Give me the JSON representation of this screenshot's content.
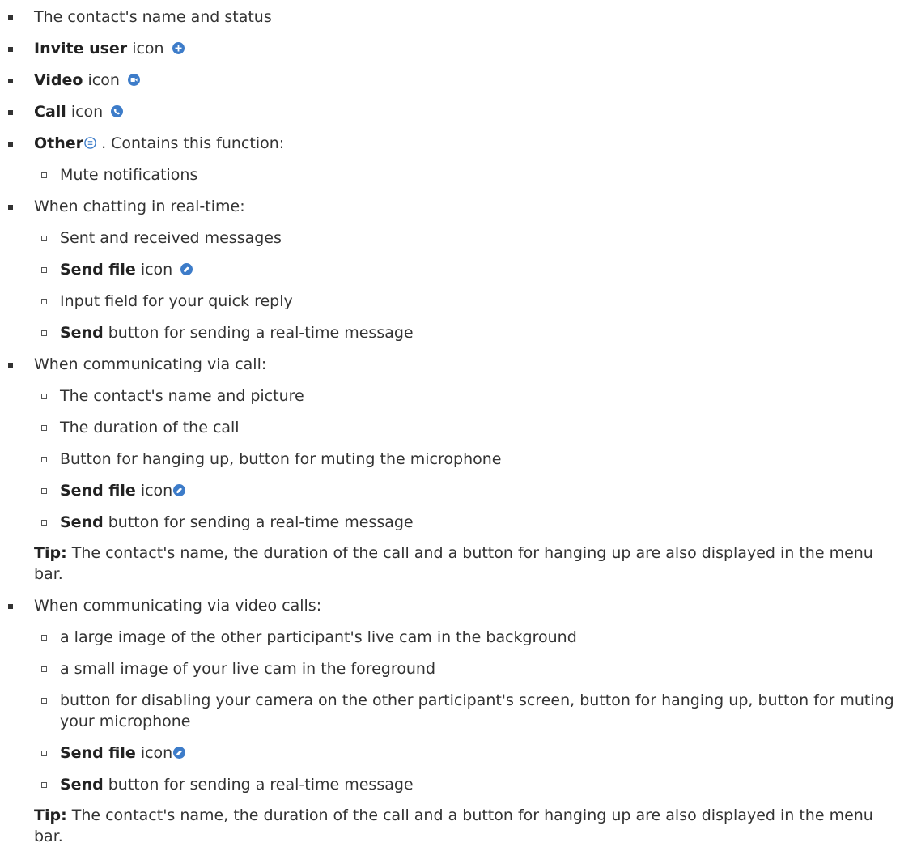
{
  "items": [
    {
      "text": "The contact's name and status"
    },
    {
      "bold": "Invite user",
      "rest": " icon",
      "icon": "invite-user-icon"
    },
    {
      "bold": "Video",
      "rest": " icon",
      "icon": "video-icon"
    },
    {
      "bold": "Call",
      "rest": " icon",
      "icon": "call-icon"
    },
    {
      "bold": "Other",
      "rest": " . Contains this function:",
      "icon": "other-menu-icon",
      "sub": [
        "Mute notifications"
      ]
    },
    {
      "text": "When chatting in real-time:",
      "sub": [
        "Sent and received messages",
        {
          "bold": "Send file",
          "rest": " icon"
        },
        "Input field for your quick reply",
        {
          "bold": "Send",
          "rest": " button for sending a real-time message"
        }
      ]
    },
    {
      "text": "When communicating via call:",
      "sub": [
        "The contact's name and picture",
        "The duration of the call",
        "Button for hanging up, button for muting the microphone",
        {
          "bold": "Send file",
          "rest": " icon"
        },
        {
          "bold": "Send",
          "rest": " button for sending a real-time message"
        }
      ],
      "tip_label": "Tip:",
      "tip_text": " The contact's name, the duration of the call and a button for hanging up are also displayed in the menu bar."
    },
    {
      "text": "When communicating via video calls:",
      "sub": [
        "a large image of the other participant's live cam in the background",
        "a small image of your live cam in the foreground",
        "button for disabling your camera on the other participant's screen, button for hanging up, button for muting your microphone",
        {
          "bold": "Send file",
          "rest": " icon"
        },
        {
          "bold": "Send",
          "rest": " button for sending a real-time message"
        }
      ],
      "tip_label": "Tip:",
      "tip_text": " The contact's name, the duration of the call and a button for hanging up are also displayed in the menu bar."
    }
  ],
  "colors": {
    "icon": "#3d7cc9",
    "text": "#333333"
  }
}
